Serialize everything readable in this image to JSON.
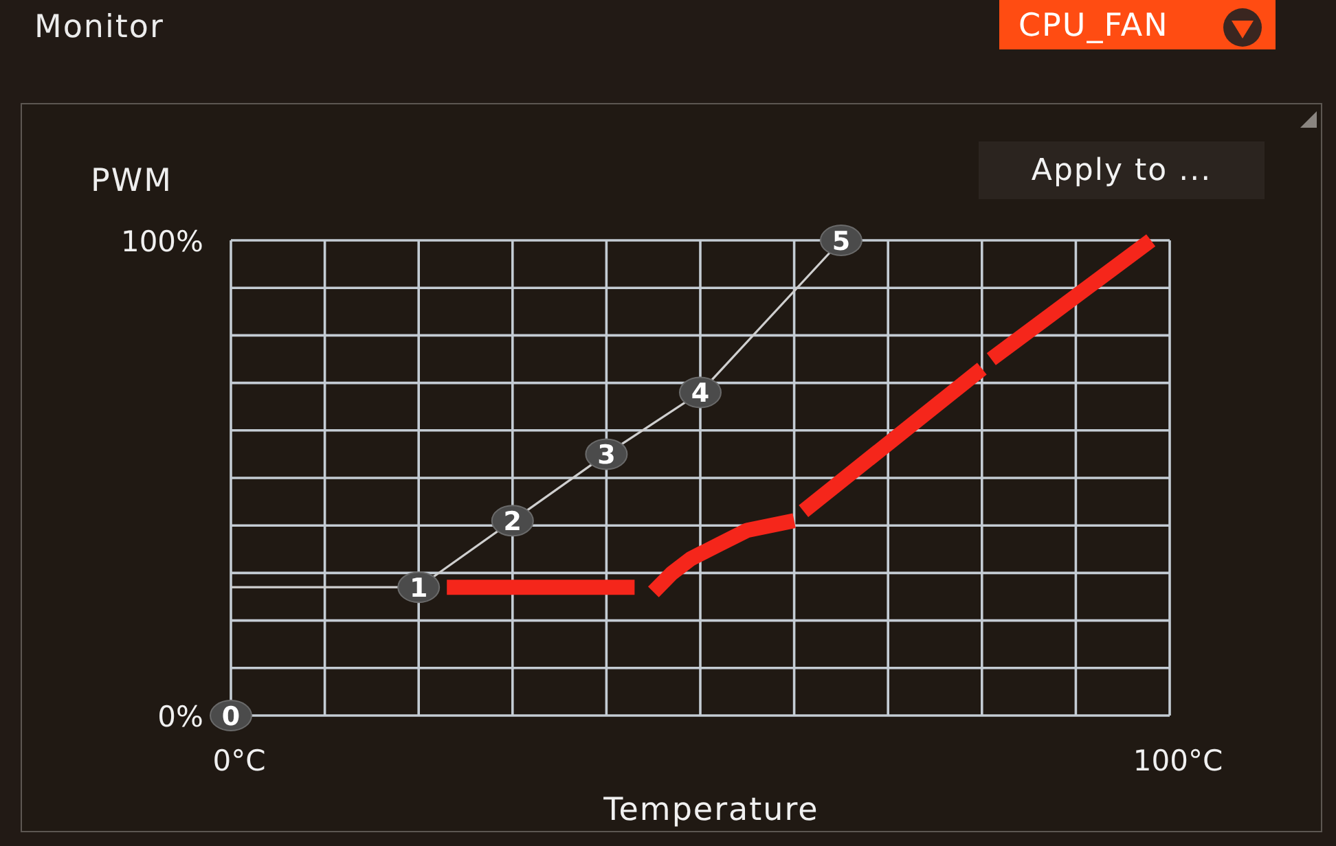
{
  "header": {
    "title": "Monitor",
    "fan_select": "CPU_FAN"
  },
  "panel": {
    "apply_button": "Apply to ...",
    "chart_data": {
      "type": "line",
      "xlabel": "Temperature",
      "ylabel": "PWM",
      "xlim": [
        0,
        100
      ],
      "ylim": [
        0,
        100
      ],
      "xticks": [
        {
          "value": 0,
          "label": "0°C"
        },
        {
          "value": 100,
          "label": "100°C"
        }
      ],
      "yticks": [
        {
          "value": 0,
          "label": "0%"
        },
        {
          "value": 100,
          "label": "100%"
        }
      ],
      "series": [
        {
          "color": "#cfcfcf",
          "marker": "circle",
          "x": [
            0,
            20,
            30,
            40,
            50,
            65
          ],
          "values": [
            27,
            27,
            41,
            55,
            68,
            100
          ]
        },
        {
          "color": "#f5261b",
          "x": [
            23,
            43,
            null,
            45,
            47,
            49,
            52,
            55,
            60,
            null,
            61,
            80,
            null,
            81,
            98
          ],
          "values": [
            27,
            27,
            null,
            26,
            30,
            33,
            36,
            39,
            41,
            null,
            43,
            73,
            null,
            75,
            100
          ]
        }
      ],
      "annotations": [
        {
          "text": "0",
          "x": 0,
          "y": 0
        },
        {
          "text": "1",
          "x": 20,
          "y": 27
        },
        {
          "text": "2",
          "x": 30,
          "y": 41
        },
        {
          "text": "3",
          "x": 40,
          "y": 55
        },
        {
          "text": "4",
          "x": 50,
          "y": 68
        },
        {
          "text": "5",
          "x": 65,
          "y": 100
        }
      ]
    }
  }
}
